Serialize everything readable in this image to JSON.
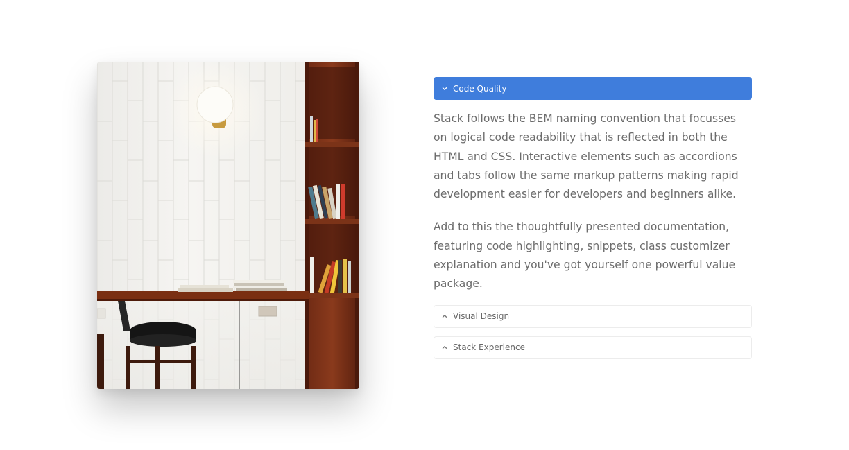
{
  "accordion": {
    "items": [
      {
        "title": "Code Quality",
        "state": "expanded",
        "paragraphs": [
          "Stack follows the BEM naming convention that focusses on logical code readability that is reflected in both the HTML and CSS. Interactive elements such as accordions and tabs follow the same markup patterns making rapid development easier for developers and beginners alike.",
          "Add to this the thoughtfully presented documentation, featuring code highlighting, snippets, class customizer explanation and you've got yourself one powerful value package."
        ]
      },
      {
        "title": "Visual Design",
        "state": "collapsed"
      },
      {
        "title": "Stack Experience",
        "state": "collapsed"
      }
    ],
    "colors": {
      "active_bg": "#3f7ddc",
      "active_text": "#ffffff",
      "inactive_border": "#ececec",
      "text": "#6c6c6c"
    }
  },
  "photo": {
    "subject": "cafe-interior-photo"
  },
  "icons": {
    "expanded": "chevron-down-icon",
    "collapsed": "chevron-up-icon"
  }
}
